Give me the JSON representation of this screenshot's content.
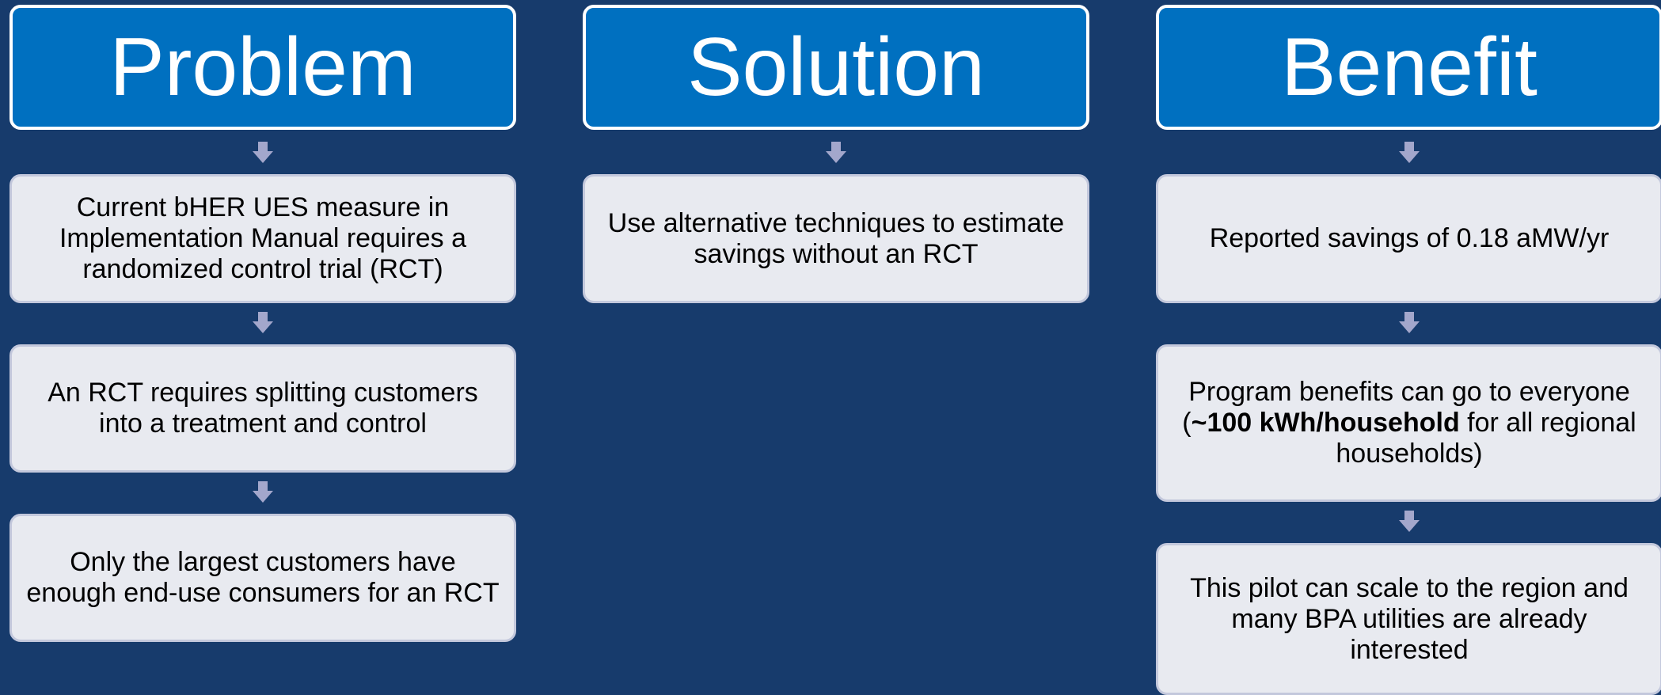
{
  "columns": [
    {
      "header": "Problem",
      "boxes": [
        {
          "text": "Current bHER UES measure in Implementation Manual requires a randomized control trial (RCT)"
        },
        {
          "text": "An RCT requires splitting customers into a treatment and control"
        },
        {
          "text": "Only the largest customers have enough end-use consumers for an RCT"
        }
      ]
    },
    {
      "header": "Solution",
      "boxes": [
        {
          "text": "Use alternative techniques to estimate savings without an RCT"
        }
      ]
    },
    {
      "header": "Benefit",
      "boxes": [
        {
          "text": "Reported savings of 0.18 aMW/yr"
        },
        {
          "pre": "Program benefits can go to everyone (",
          "bold": "~100 kWh/household",
          "post": " for all regional households)"
        },
        {
          "text": "This pilot can scale to the region and many BPA utilities are already interested"
        }
      ]
    }
  ],
  "colors": {
    "background": "#173b6c",
    "header_fill": "#0070c0",
    "header_border": "#ffffff",
    "box_fill": "#e8eaf0",
    "box_border": "#c3c8dc",
    "arrow": "#a3a7cc"
  },
  "icons": [
    "down-arrow-icon"
  ]
}
